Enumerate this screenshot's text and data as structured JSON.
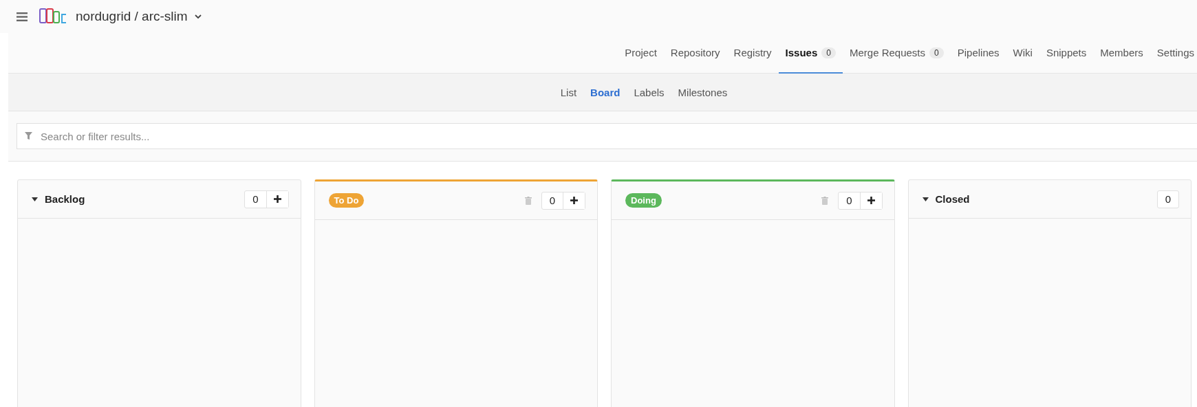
{
  "project": {
    "title": "nordugrid / arc-slim"
  },
  "nav": [
    {
      "label": "Project",
      "selected": false
    },
    {
      "label": "Repository",
      "selected": false
    },
    {
      "label": "Registry",
      "selected": false
    },
    {
      "label": "Issues",
      "count": "0",
      "selected": true
    },
    {
      "label": "Merge Requests",
      "count": "0",
      "selected": false
    },
    {
      "label": "Pipelines",
      "selected": false
    },
    {
      "label": "Wiki",
      "selected": false
    },
    {
      "label": "Snippets",
      "selected": false
    },
    {
      "label": "Members",
      "selected": false
    },
    {
      "label": "Settings",
      "selected": false
    }
  ],
  "subnav": [
    {
      "label": "List",
      "selected": false
    },
    {
      "label": "Board",
      "selected": true
    },
    {
      "label": "Labels",
      "selected": false
    },
    {
      "label": "Milestones",
      "selected": false
    }
  ],
  "search": {
    "placeholder": "Search or filter results..."
  },
  "lists": [
    {
      "kind": "plain",
      "title": "Backlog",
      "count": "0",
      "can_add": true
    },
    {
      "kind": "label",
      "title": "To Do",
      "color": "#eea435",
      "count": "0",
      "can_add": true
    },
    {
      "kind": "label",
      "title": "Doing",
      "color": "#5cb85c",
      "count": "0",
      "can_add": true
    },
    {
      "kind": "plain",
      "title": "Closed",
      "count": "0",
      "can_add": false
    }
  ]
}
